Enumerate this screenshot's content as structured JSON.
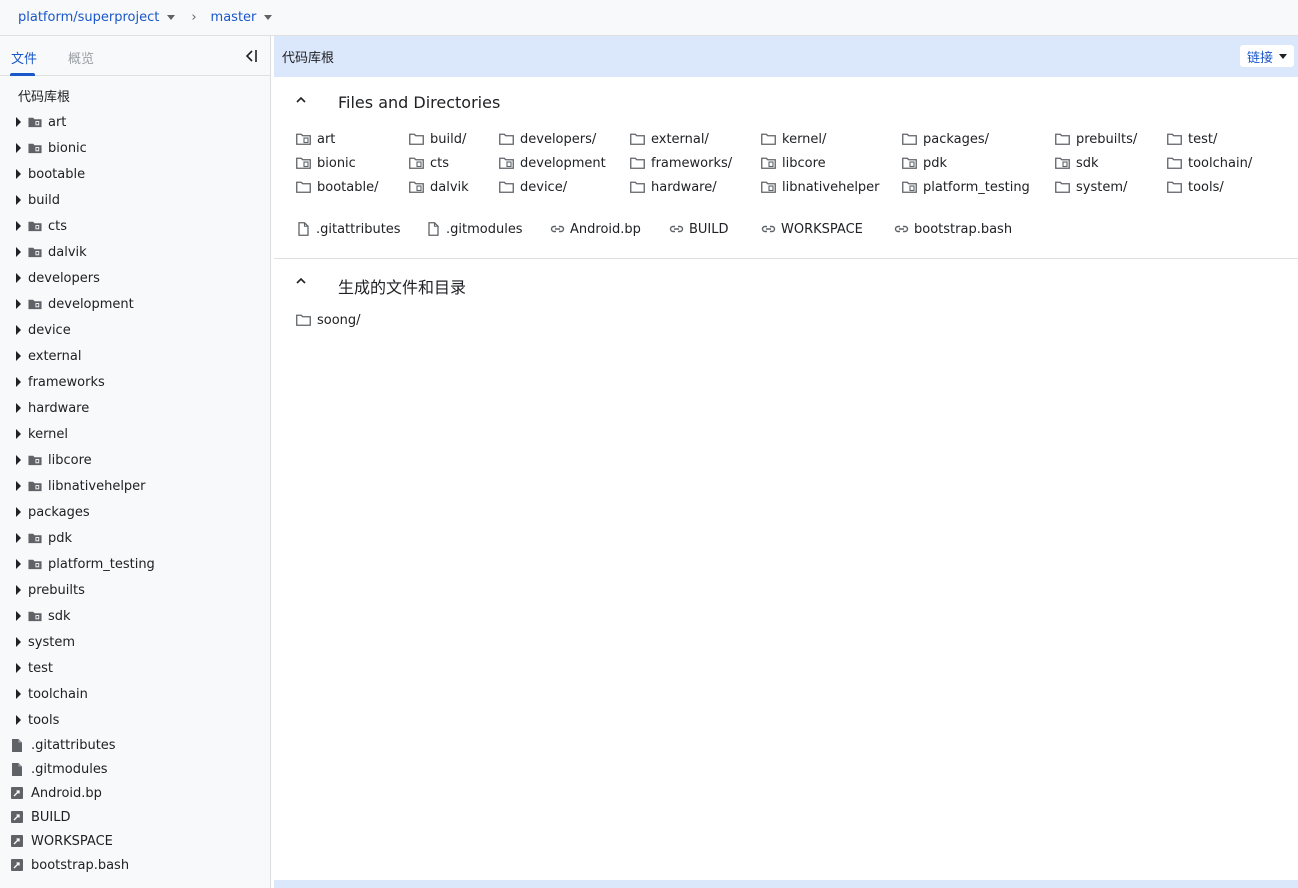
{
  "breadcrumb": {
    "project": "platform/superproject",
    "branch": "master"
  },
  "sidebar": {
    "tab_files": "文件",
    "tab_overview": "概览",
    "root_label": "代码库根",
    "dirs": [
      {
        "name": "art",
        "submodule": true
      },
      {
        "name": "bionic",
        "submodule": true
      },
      {
        "name": "bootable",
        "submodule": false
      },
      {
        "name": "build",
        "submodule": false
      },
      {
        "name": "cts",
        "submodule": true
      },
      {
        "name": "dalvik",
        "submodule": true
      },
      {
        "name": "developers",
        "submodule": false
      },
      {
        "name": "development",
        "submodule": true
      },
      {
        "name": "device",
        "submodule": false
      },
      {
        "name": "external",
        "submodule": false
      },
      {
        "name": "frameworks",
        "submodule": false
      },
      {
        "name": "hardware",
        "submodule": false
      },
      {
        "name": "kernel",
        "submodule": false
      },
      {
        "name": "libcore",
        "submodule": true
      },
      {
        "name": "libnativehelper",
        "submodule": true
      },
      {
        "name": "packages",
        "submodule": false
      },
      {
        "name": "pdk",
        "submodule": true
      },
      {
        "name": "platform_testing",
        "submodule": true
      },
      {
        "name": "prebuilts",
        "submodule": false
      },
      {
        "name": "sdk",
        "submodule": true
      },
      {
        "name": "system",
        "submodule": false
      },
      {
        "name": "test",
        "submodule": false
      },
      {
        "name": "toolchain",
        "submodule": false
      },
      {
        "name": "tools",
        "submodule": false
      }
    ],
    "files": [
      {
        "name": ".gitattributes",
        "type": "file"
      },
      {
        "name": ".gitmodules",
        "type": "file"
      },
      {
        "name": "Android.bp",
        "type": "symlink"
      },
      {
        "name": "BUILD",
        "type": "symlink"
      },
      {
        "name": "WORKSPACE",
        "type": "symlink"
      },
      {
        "name": "bootstrap.bash",
        "type": "symlink"
      }
    ]
  },
  "main": {
    "header_title": "代码库根",
    "link_button": "链接",
    "section1_title": "Files and Directories",
    "section2_title": "生成的文件和目录",
    "grid": [
      {
        "name": "art",
        "submodule": true
      },
      {
        "name": "bionic",
        "submodule": true
      },
      {
        "name": "bootable/",
        "submodule": false
      },
      {
        "name": "build/",
        "submodule": false
      },
      {
        "name": "cts",
        "submodule": true
      },
      {
        "name": "dalvik",
        "submodule": true
      },
      {
        "name": "developers/",
        "submodule": false
      },
      {
        "name": "development",
        "submodule": true
      },
      {
        "name": "device/",
        "submodule": false
      },
      {
        "name": "external/",
        "submodule": false
      },
      {
        "name": "frameworks/",
        "submodule": false
      },
      {
        "name": "hardware/",
        "submodule": false
      },
      {
        "name": "kernel/",
        "submodule": false
      },
      {
        "name": "libcore",
        "submodule": true
      },
      {
        "name": "libnativehelper",
        "submodule": true
      },
      {
        "name": "packages/",
        "submodule": false
      },
      {
        "name": "pdk",
        "submodule": true
      },
      {
        "name": "platform_testing",
        "submodule": true
      },
      {
        "name": "prebuilts/",
        "submodule": false
      },
      {
        "name": "sdk",
        "submodule": true
      },
      {
        "name": "system/",
        "submodule": false
      },
      {
        "name": "test/",
        "submodule": false
      },
      {
        "name": "toolchain/",
        "submodule": false
      },
      {
        "name": "tools/",
        "submodule": false
      }
    ],
    "files": [
      {
        "name": ".gitattributes",
        "type": "file"
      },
      {
        "name": ".gitmodules",
        "type": "file"
      },
      {
        "name": "Android.bp",
        "type": "link"
      },
      {
        "name": "BUILD",
        "type": "link"
      },
      {
        "name": "WORKSPACE",
        "type": "link"
      },
      {
        "name": "bootstrap.bash",
        "type": "link"
      }
    ],
    "generated": [
      {
        "name": "soong/",
        "submodule": false
      }
    ]
  },
  "colors": {
    "accent": "#1a57c9",
    "header_bg": "#dbe7fb",
    "sidebar_bg": "#f8f9fa"
  }
}
